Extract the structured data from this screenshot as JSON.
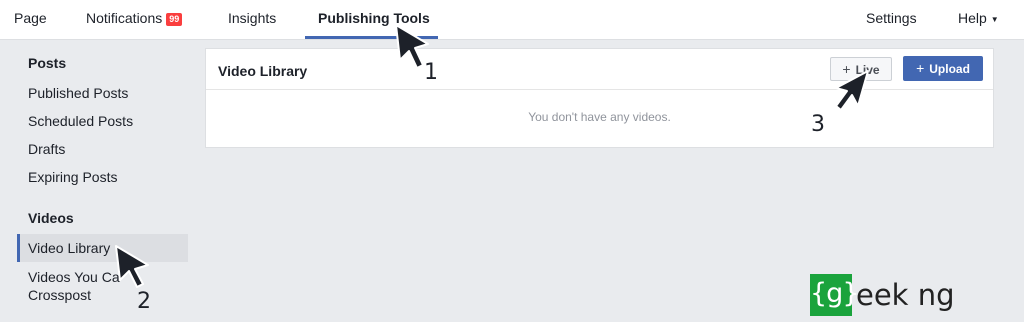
{
  "topnav": {
    "page": "Page",
    "notifications": "Notifications",
    "notifications_count": "99",
    "insights": "Insights",
    "publishing_tools": "Publishing Tools",
    "settings": "Settings",
    "help": "Help"
  },
  "sidebar": {
    "posts_heading": "Posts",
    "posts_items": [
      "Published Posts",
      "Scheduled Posts",
      "Drafts",
      "Expiring Posts"
    ],
    "videos_heading": "Videos",
    "videos_items": [
      "Video Library",
      "Videos You Ca",
      "Crosspost"
    ]
  },
  "video_library": {
    "title": "Video Library",
    "live_button": "Live",
    "upload_button": "Upload",
    "empty_message": "You don't have any videos."
  },
  "annotations": {
    "step1": "1",
    "step2": "2",
    "step3": "3"
  },
  "watermark": {
    "box_text": "{g}",
    "text": "eek ng"
  },
  "colors": {
    "accent": "#4267b2",
    "badge": "#fa3e3e",
    "logo_green": "#1aa33c"
  }
}
